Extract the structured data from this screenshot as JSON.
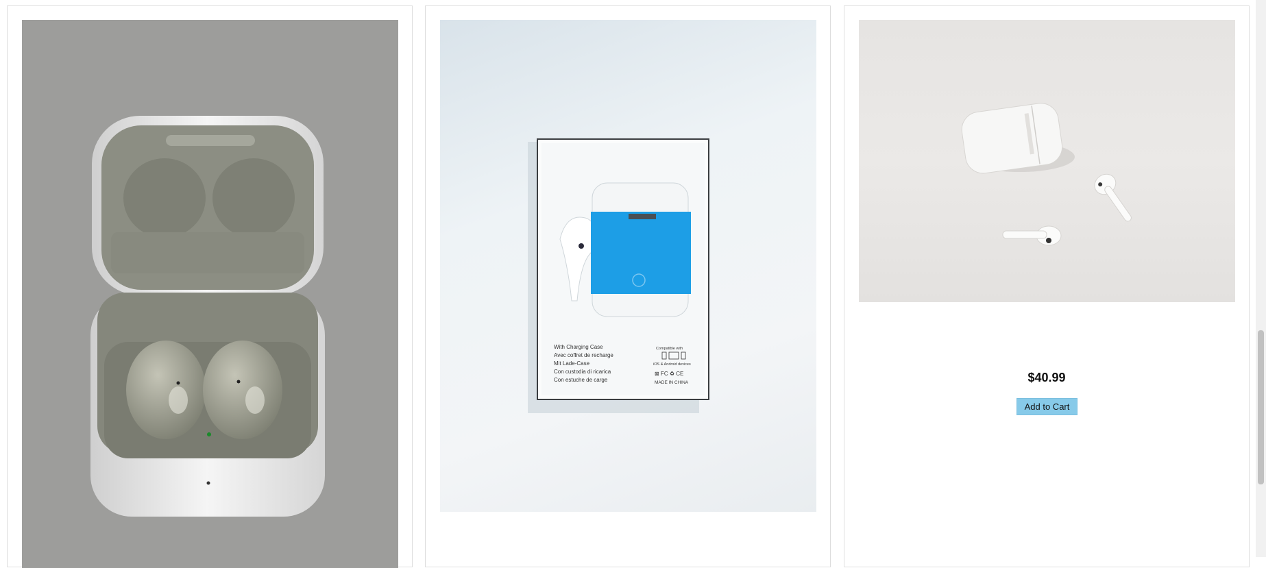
{
  "products": [
    {
      "image_alt": "",
      "price": "",
      "button_label": ""
    },
    {
      "image_alt": "",
      "price": "",
      "button_label": "",
      "box_print": {
        "lines": [
          "With Charging Case",
          "Avec coffret de recharge",
          "Mit Lade-Case",
          "Con custodia di ricarica",
          "Con estuche de carge"
        ],
        "compatible_label": "Compatible with",
        "compatible_sub": "iOS & Android devices",
        "origin": "MADE IN CHINA"
      }
    },
    {
      "image_alt": "",
      "price": "$40.99",
      "button_label": "Add to Cart"
    }
  ],
  "colors": {
    "button_bg": "#87cae9",
    "card_border": "#dddddd"
  },
  "icons": [
    "photo-earbuds-open-case",
    "photo-earbuds-box",
    "photo-white-earbuds"
  ]
}
